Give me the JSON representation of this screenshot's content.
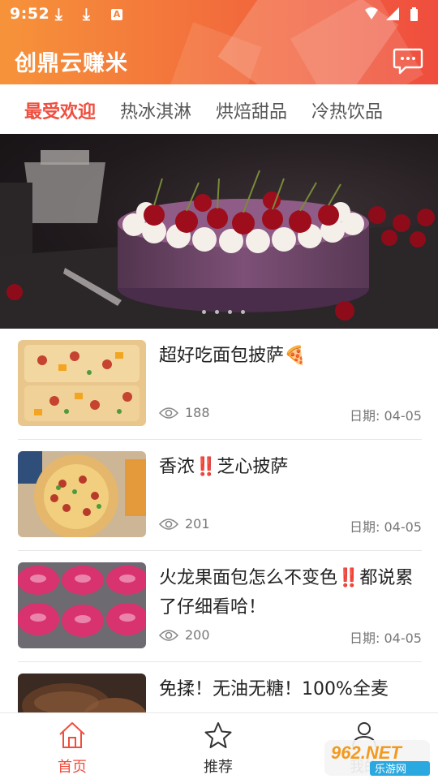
{
  "status": {
    "time": "9:52",
    "letter_icon": "A"
  },
  "header": {
    "title": "创鼎云赚米",
    "chat_icon": "chat-bubble-icon",
    "gradient": [
      "#f6933a",
      "#ef4e3e"
    ]
  },
  "tabs": [
    {
      "label": "最受欢迎",
      "active": true
    },
    {
      "label": "热冰淇淋",
      "active": false
    },
    {
      "label": "烘焙甜品",
      "active": false
    },
    {
      "label": "冷热饮品",
      "active": false
    }
  ],
  "banner": {
    "image": "cherry-cake-photo",
    "page_count": 4
  },
  "articles": [
    {
      "title": "超好吃面包披萨🍕",
      "views": "188",
      "date": "日期: 04-05",
      "thumb": "pizza-bread-photo"
    },
    {
      "title": "香浓‼️芝心披萨",
      "views": "201",
      "date": "日期: 04-05",
      "thumb": "cheese-pizza-photo"
    },
    {
      "title": "火龙果面包怎么不变色‼️都说累了仔细看哈！",
      "views": "200",
      "date": "日期: 04-05",
      "thumb": "dragonfruit-bread-photo"
    },
    {
      "title": "免揉！无油无糖！100%全麦",
      "views": "",
      "date": "",
      "thumb": "wholewheat-bread-photo"
    }
  ],
  "bottom_nav": [
    {
      "label": "首页",
      "icon": "home-icon",
      "active": true
    },
    {
      "label": "推荐",
      "icon": "star-icon",
      "active": false
    },
    {
      "label": "我的",
      "icon": "person-icon",
      "active": false
    }
  ],
  "watermark": {
    "text_top": "962.NET",
    "text_bottom": "乐游网"
  },
  "colors": {
    "accent": "#ef4e3e",
    "text": "#222222",
    "muted": "#777777"
  }
}
